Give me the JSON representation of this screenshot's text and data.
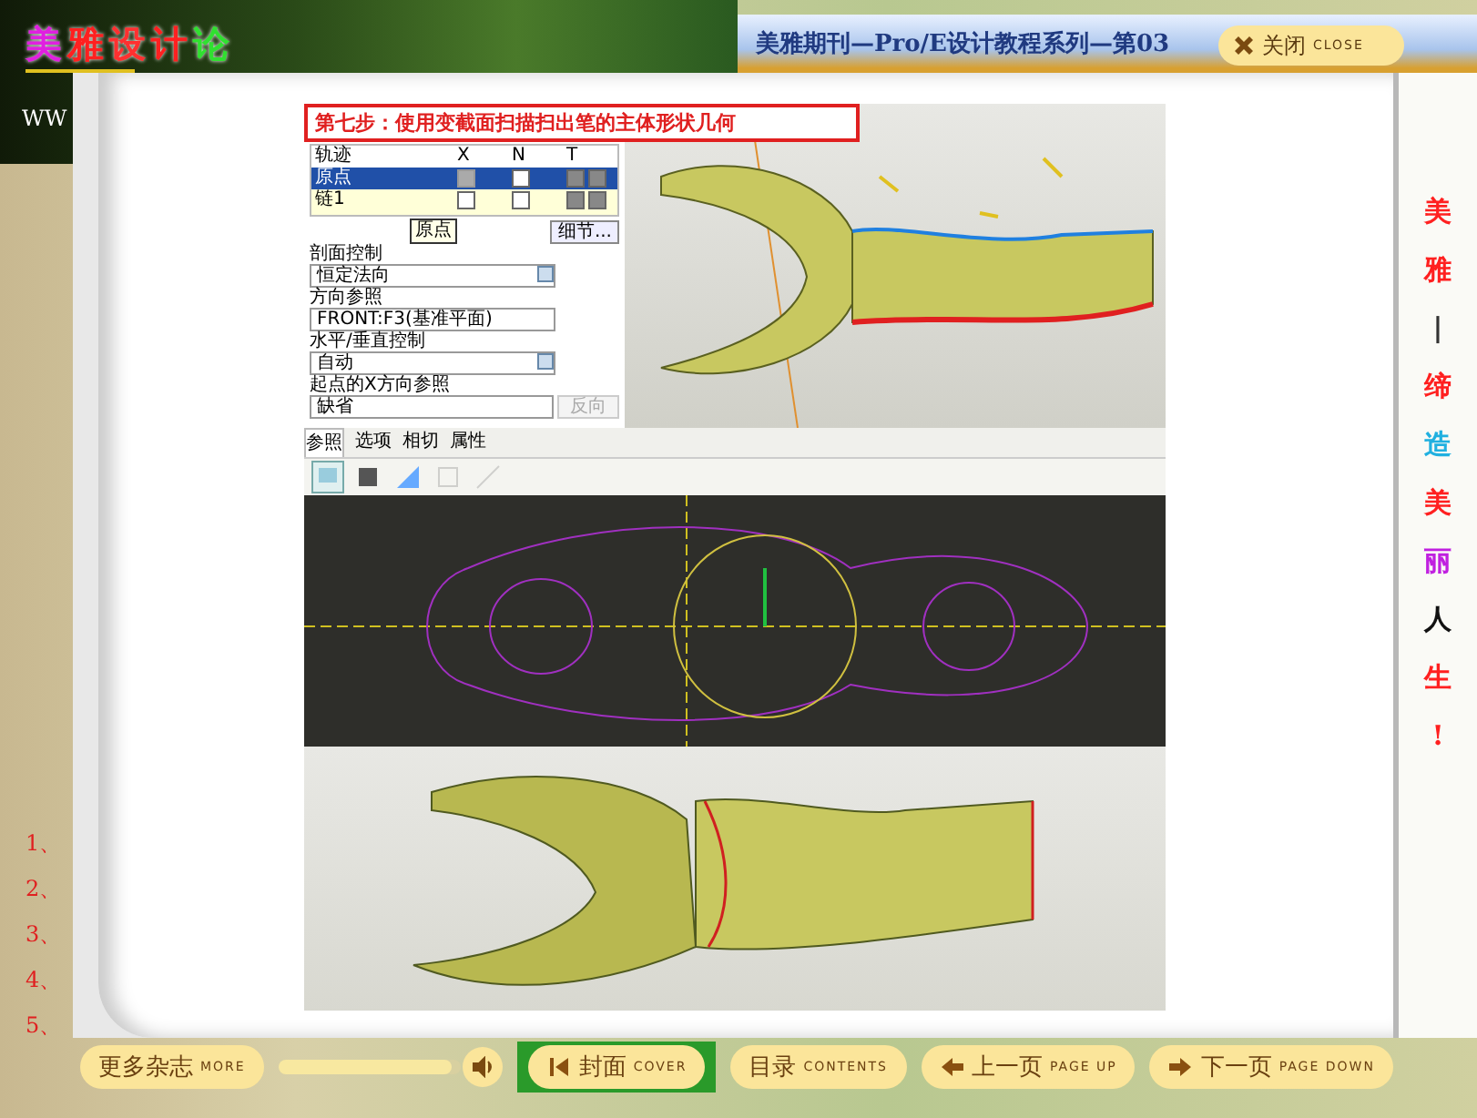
{
  "banner": {
    "logo": [
      {
        "char": "美",
        "color": "#e020e0"
      },
      {
        "char": "雅",
        "color": "#ff2020"
      },
      {
        "char": "设",
        "color": "#ff3030"
      },
      {
        "char": "计",
        "color": "#ff2020"
      },
      {
        "char": "论",
        "color": "#30e030"
      }
    ],
    "url": "WW"
  },
  "title_bar": {
    "title": "美雅期刊—Pro/E设计教程系列—第03",
    "close_button": {
      "label": "关闭",
      "sub": "CLOSE"
    }
  },
  "slogan": [
    {
      "char": "美",
      "color": "#ff2020"
    },
    {
      "char": "雅",
      "color": "#ff2020"
    },
    {
      "char": "|",
      "color": "#333333"
    },
    {
      "char": "缔",
      "color": "#ff2020"
    },
    {
      "char": "造",
      "color": "#20b0e0"
    },
    {
      "char": "美",
      "color": "#ff2020"
    },
    {
      "char": "丽",
      "color": "#c020e0"
    },
    {
      "char": "人",
      "color": "#111111"
    },
    {
      "char": "生",
      "color": "#ff2020"
    },
    {
      "char": "!",
      "color": "#ff2020"
    }
  ],
  "chapter_numbers": [
    "1、",
    "2、",
    "3、",
    "4、",
    "5、"
  ],
  "document": {
    "heading": "第七步：使用变截面扫描扫出笔的主体形状几何",
    "trajectories": {
      "columns": [
        "轨迹",
        "X",
        "N",
        "T"
      ],
      "rows": [
        {
          "name": "原点",
          "selected": true,
          "x_disabled": true
        },
        {
          "name": "链1",
          "selected": false,
          "x_disabled": false
        }
      ],
      "tooltip": "原点"
    },
    "details_button": "细节...",
    "fields": [
      {
        "kind": "dropdown",
        "label": "剖面控制",
        "value": "恒定法向"
      },
      {
        "kind": "text",
        "label": "方向参照",
        "value": "FRONT:F3(基准平面)"
      },
      {
        "kind": "dropdown",
        "label": "水平/垂直控制",
        "value": "自动"
      },
      {
        "kind": "text",
        "label": "起点的X方向参照",
        "value": "缺省",
        "button": {
          "label": "反向",
          "disabled": true
        }
      }
    ],
    "tabs": [
      {
        "label": "参照",
        "selected": true
      },
      {
        "label": "选项",
        "selected": false
      },
      {
        "label": "相切",
        "selected": false
      },
      {
        "label": "属性",
        "selected": false
      }
    ],
    "tools": [
      {
        "selected": true,
        "disabled": false
      },
      {
        "selected": false,
        "disabled": false
      },
      {
        "selected": false,
        "disabled": false
      },
      {
        "selected": false,
        "disabled": true
      },
      {
        "selected": false,
        "disabled": true
      }
    ]
  },
  "footer": {
    "more_button": {
      "label": "更多杂志",
      "sub": "MORE"
    },
    "volume": {
      "level": 0.95
    },
    "nav_buttons": [
      {
        "kind": "cover",
        "label": "封面",
        "sub": "COVER"
      },
      {
        "kind": "contents",
        "label": "目录",
        "sub": "CONTENTS"
      },
      {
        "kind": "prev",
        "label": "上一页",
        "sub": "PAGE UP"
      },
      {
        "kind": "next",
        "label": "下一页",
        "sub": "PAGE DOWN"
      }
    ]
  }
}
